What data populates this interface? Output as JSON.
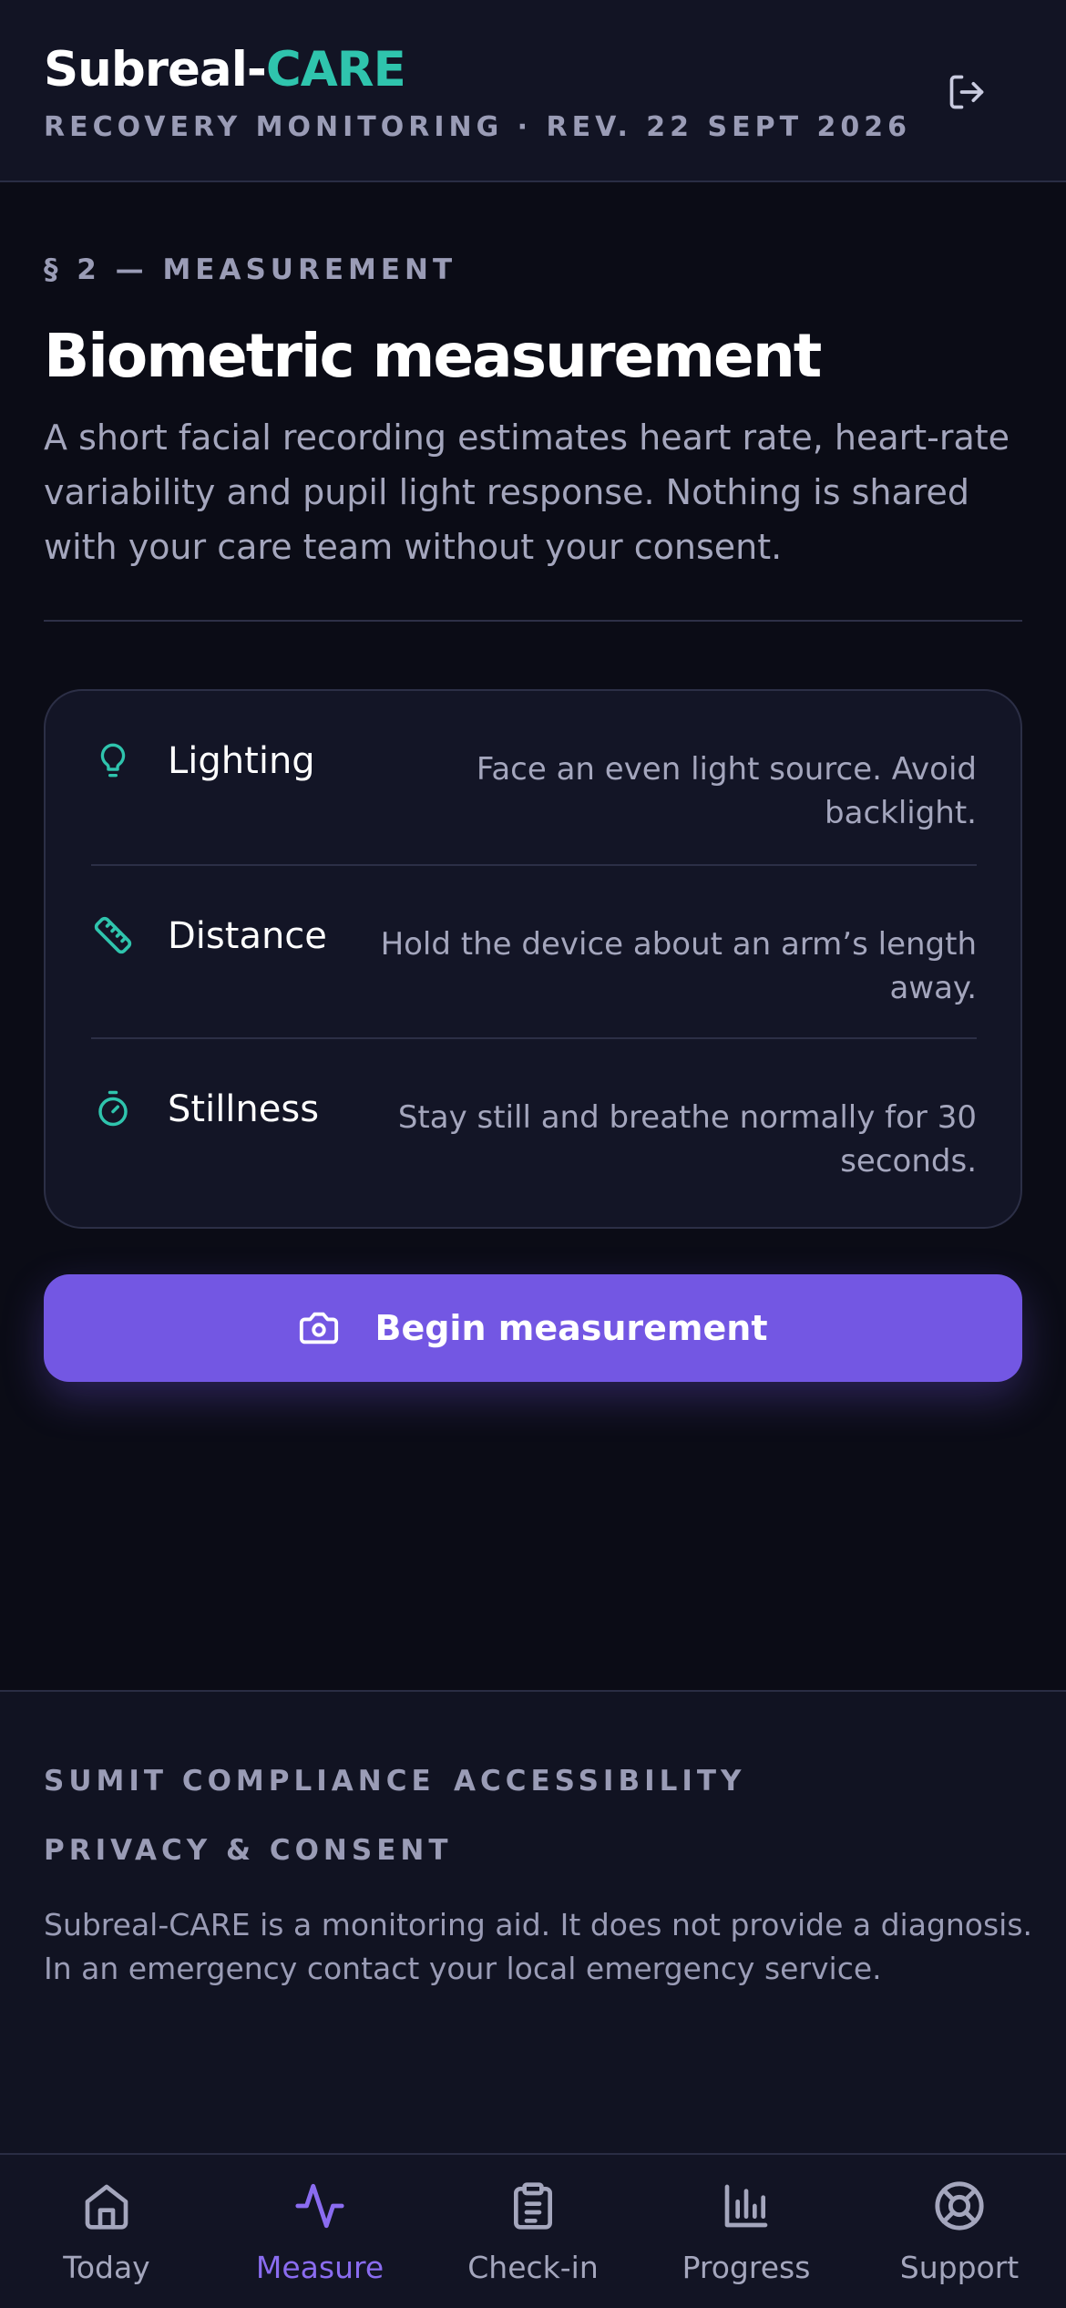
{
  "header": {
    "brand_prefix": "Subreal-",
    "brand_accent": "CARE",
    "subtitle": "RECOVERY MONITORING · REV. 22 SEPT 2026",
    "logout_icon": "logout-icon"
  },
  "section": {
    "eyebrow": "§ 2 — MEASUREMENT",
    "title": "Biometric measurement",
    "description": "A short facial recording estimates heart rate, heart-rate variability and pupil light response. Nothing is shared with your care team without your consent."
  },
  "checklist": [
    {
      "icon": "lightbulb-icon",
      "label": "Lighting",
      "desc": "Face an even light source. Avoid backlight."
    },
    {
      "icon": "ruler-icon",
      "label": "Distance",
      "desc": "Hold the device about an arm’s length away."
    },
    {
      "icon": "stopwatch-icon",
      "label": "Stillness",
      "desc": "Stay still and breathe normally for 30 seconds."
    }
  ],
  "cta": {
    "icon": "camera-icon",
    "label": "Begin measurement"
  },
  "footer": {
    "links": [
      "SUMIT COMPLIANCE",
      "ACCESSIBILITY",
      "PRIVACY & CONSENT"
    ],
    "disclaimer": "Subreal-CARE is a monitoring aid. It does not provide a diagnosis. In an emergency contact your local emergency service."
  },
  "tabs": [
    {
      "icon": "home-icon",
      "label": "Today",
      "active": false
    },
    {
      "icon": "pulse-icon",
      "label": "Measure",
      "active": true
    },
    {
      "icon": "clipboard-icon",
      "label": "Check-in",
      "active": false
    },
    {
      "icon": "bar-chart-icon",
      "label": "Progress",
      "active": false
    },
    {
      "icon": "lifebuoy-icon",
      "label": "Support",
      "active": false
    }
  ],
  "colors": {
    "background": "#0b0c16",
    "accent_teal": "#2fc4ad",
    "accent_purple": "#7357e3",
    "active_tab": "#8a6cf0",
    "muted_text": "#a4a6bd"
  }
}
